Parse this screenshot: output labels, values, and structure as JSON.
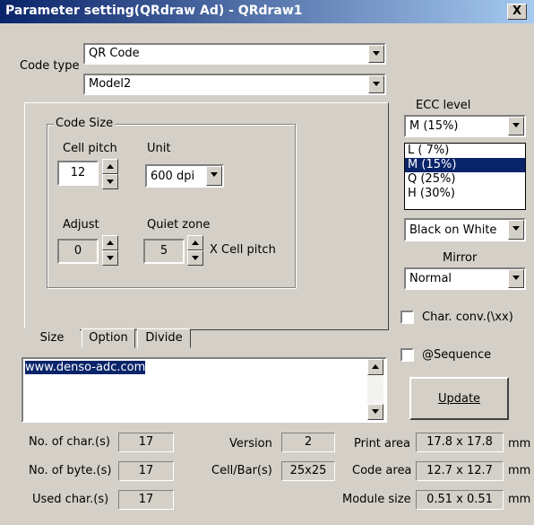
{
  "window": {
    "title": "Parameter setting(QRdraw Ad) - QRdraw1",
    "close_label": "X"
  },
  "code_type": {
    "label": "Code type",
    "value": "QR Code",
    "model": "Model2"
  },
  "code_size": {
    "group_label": "Code Size",
    "cell_pitch_label": "Cell pitch",
    "cell_pitch": "12",
    "unit_label": "Unit",
    "unit": "600 dpi",
    "adjust_label": "Adjust",
    "adjust": "0",
    "quiet_zone_label": "Quiet zone",
    "quiet_zone": "5",
    "quiet_zone_suffix": "X Cell pitch"
  },
  "tabs": {
    "size": "Size",
    "option": "Option",
    "divide": "Divide"
  },
  "data_text": "www.denso-adc.com",
  "ecc": {
    "label": "ECC level",
    "value": "M (15%)",
    "options": [
      "L ( 7%)",
      "M (15%)",
      "Q (25%)",
      "H (30%)"
    ],
    "selected_index": 1
  },
  "color": {
    "value": "Black on White"
  },
  "mirror": {
    "label": "Mirror",
    "value": "Normal"
  },
  "checks": {
    "char_conv": "Char. conv.(\\xx)",
    "sequence": "@Sequence"
  },
  "update_label": "Update",
  "stats": {
    "no_chars_label": "No. of char.(s)",
    "no_chars": "17",
    "no_bytes_label": "No. of byte.(s)",
    "no_bytes": "17",
    "used_chars_label": "Used char.(s)",
    "used_chars": "17",
    "version_label": "Version",
    "version": "2",
    "cellbar_label": "Cell/Bar(s)",
    "cellbar": "25x25",
    "print_area_label": "Print area",
    "print_area": "17.8 x 17.8",
    "code_area_label": "Code area",
    "code_area": "12.7 x 12.7",
    "module_size_label": "Module size",
    "module_size": "0.51 x 0.51",
    "unit_mm": "mm"
  }
}
